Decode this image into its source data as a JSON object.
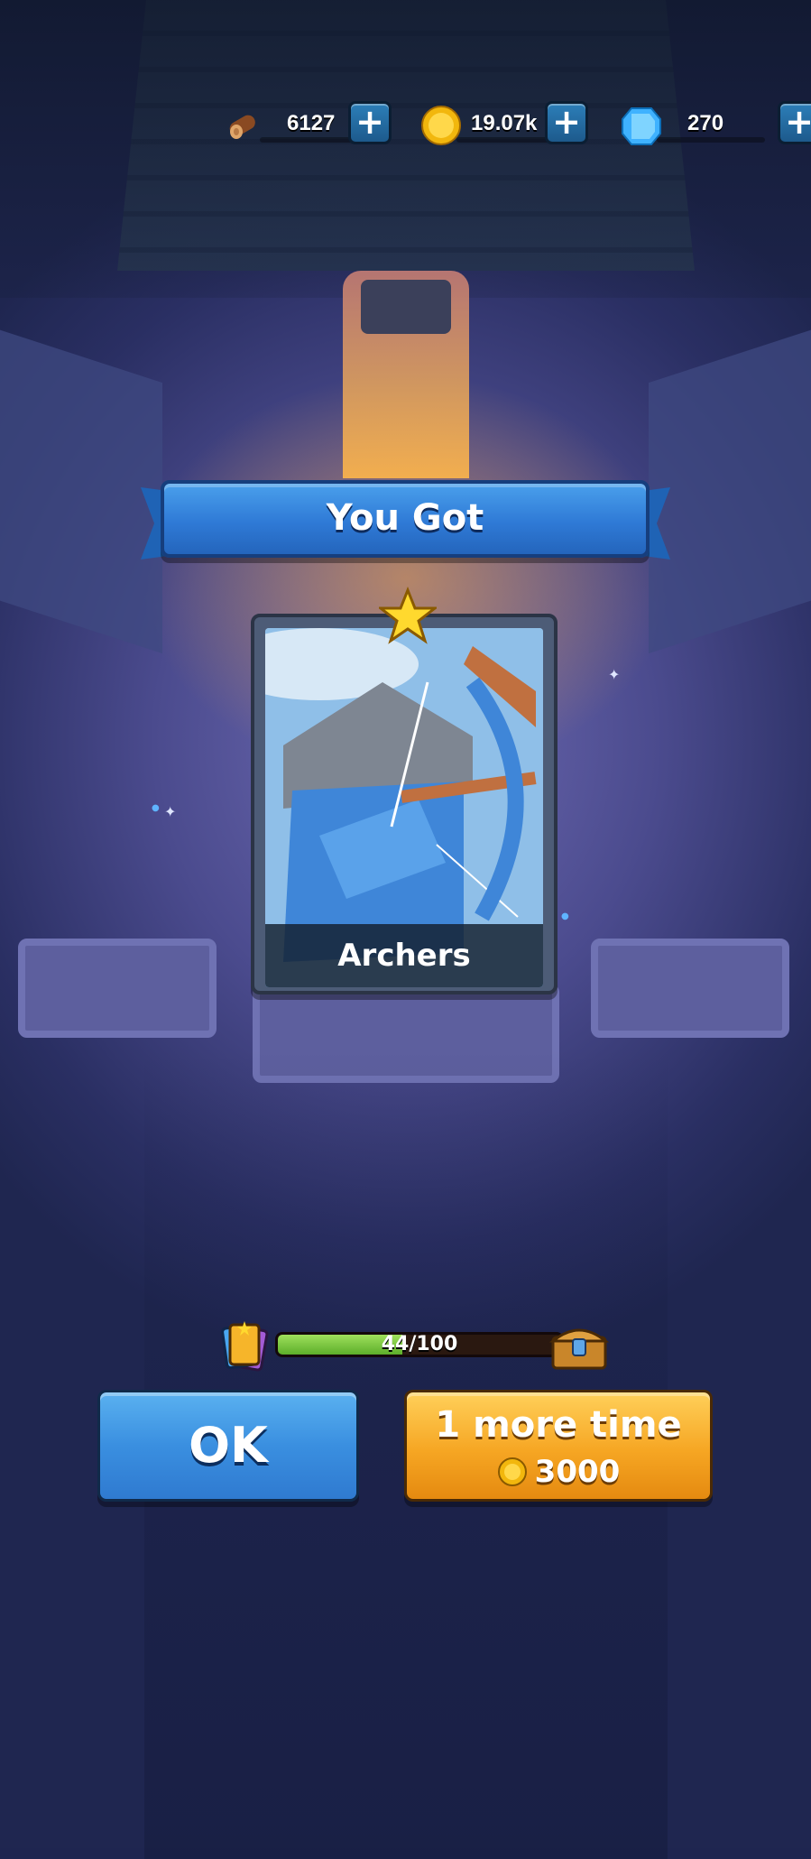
{
  "resources": {
    "wood": {
      "value": "6127",
      "icon": "wood-log-icon"
    },
    "gold": {
      "value": "19.07k",
      "icon": "gold-coin-icon"
    },
    "gems": {
      "value": "270",
      "icon": "blue-gem-icon"
    },
    "plus_label": "+"
  },
  "reward": {
    "banner_title": "You Got",
    "card_name": "Archers",
    "card_icon": "archer-card-art",
    "rarity_icon": "star-icon"
  },
  "collection_progress": {
    "text": "44/100",
    "current": 44,
    "max": 100
  },
  "buttons": {
    "ok_label": "OK",
    "more_label": "1 more time",
    "more_cost": "3000"
  },
  "colors": {
    "ok_button": "#3a8fe0",
    "more_button": "#f6a623",
    "banner": "#2f7ad6",
    "progress_fill": "#7cc63c"
  }
}
